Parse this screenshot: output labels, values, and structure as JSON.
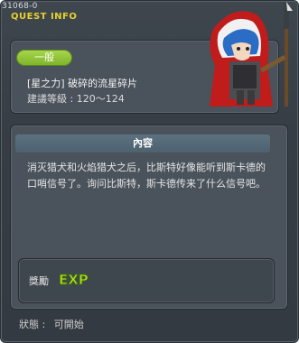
{
  "window": {
    "quest_id": "31068-0",
    "title": "QUEST INFO"
  },
  "quest": {
    "category": "一般",
    "name": "[星之力] 破碎的流星碎片",
    "level_label": "建議等級 :",
    "level_range": "120～124",
    "character_icon": "knight-character-icon"
  },
  "content": {
    "header": "內容",
    "description": "消灭猎犬和火焰猎犬之后，比斯特好像能听到斯卡德的口哨信号了。询问比斯特，斯卡德传来了什么信号吧。"
  },
  "reward": {
    "label": "獎勵",
    "items": [
      "EXP"
    ]
  },
  "status": {
    "label": "狀態 :",
    "value": "可開始"
  },
  "colors": {
    "title_yellow": "#e8d030",
    "badge_green": "#8fc43a",
    "panel_bg": "#4a525b",
    "header_bg": "#56697a",
    "exp_green": "#b7e020"
  }
}
